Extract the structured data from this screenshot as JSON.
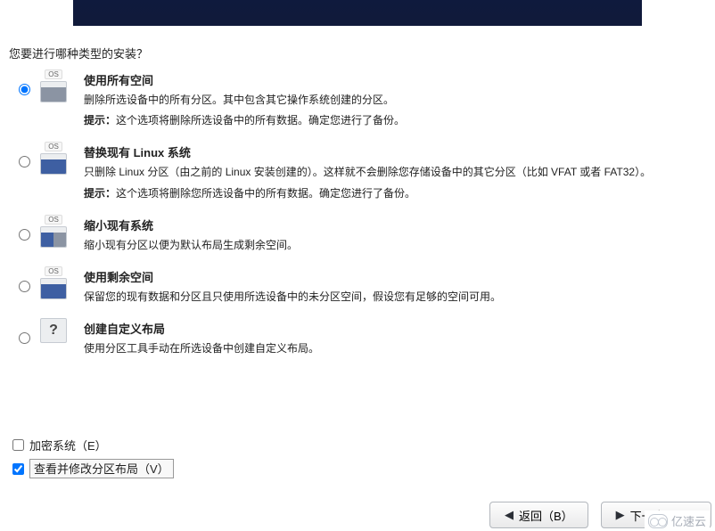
{
  "question": "您要进行哪种类型的安装？",
  "options": [
    {
      "title": "使用所有空间",
      "desc": "删除所选设备中的所有分区。其中包含其它操作系统创建的分区。",
      "hint_label": "提示：",
      "hint": "这个选项将删除所选设备中的所有数据。确定您进行了备份。",
      "os_tag": "OS",
      "selected": true,
      "icon": "gray"
    },
    {
      "title": "替换现有 Linux 系统",
      "desc": "只删除 Linux 分区（由之前的 Linux 安装创建的）。这样就不会删除您存储设备中的其它分区（比如 VFAT 或者 FAT32）。",
      "hint_label": "提示：",
      "hint": "这个选项将删除您所选设备中的所有数据。确定您进行了备份。",
      "os_tag": "OS",
      "selected": false,
      "icon": "blue"
    },
    {
      "title": "缩小现有系统",
      "desc": "缩小现有分区以便为默认布局生成剩余空间。",
      "os_tag": "OS",
      "selected": false,
      "icon": "half"
    },
    {
      "title": "使用剩余空间",
      "desc": "保留您的现有数据和分区且只使用所选设备中的未分区空间，假设您有足够的空间可用。",
      "os_tag": "OS",
      "selected": false,
      "icon": "blue"
    },
    {
      "title": "创建自定义布局",
      "desc": "使用分区工具手动在所选设备中创建自定义布局。",
      "selected": false,
      "icon": "question"
    }
  ],
  "checks": {
    "encrypt": {
      "label": "加密系统（E）",
      "checked": false
    },
    "review": {
      "label": "查看并修改分区布局（V）",
      "checked": true
    }
  },
  "buttons": {
    "back": "返回（B）",
    "next": "下一步（N）"
  },
  "watermark": "亿速云"
}
